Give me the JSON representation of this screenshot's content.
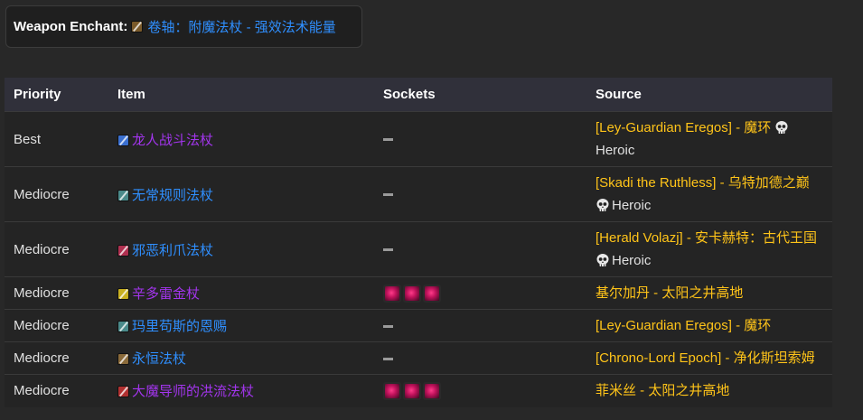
{
  "enchant": {
    "label": "Weapon Enchant:",
    "name": "卷轴：附魔法杖 - 强效法术能量",
    "icon": "scroll-icon",
    "color": "#2f8fff"
  },
  "table": {
    "headers": {
      "priority": "Priority",
      "item": "Item",
      "sockets": "Sockets",
      "source": "Source"
    },
    "rows": [
      {
        "priority": "Best",
        "item": "龙人战斗法杖",
        "item_quality": "epic",
        "item_icon": "staff-icon",
        "item_icon_color": "#3a6fd0",
        "sockets": "—",
        "sockets_count": 0,
        "source": "[Ley-Guardian Eregos] - 魔环",
        "heroic": "Heroic"
      },
      {
        "priority": "Mediocre",
        "item": "无常规则法杖",
        "item_quality": "rare",
        "item_icon": "staff-icon",
        "item_icon_color": "#4a8a8a",
        "sockets": "—",
        "sockets_count": 0,
        "source": "[Skadi the Ruthless] - 乌特加德之巅",
        "heroic": "Heroic"
      },
      {
        "priority": "Mediocre",
        "item": "邪恶利爪法杖",
        "item_quality": "rare",
        "item_icon": "staff-icon",
        "item_icon_color": "#b03050",
        "sockets": "—",
        "sockets_count": 0,
        "source": "[Herald Volazj] - 安卡赫特：古代王国",
        "heroic": "Heroic"
      },
      {
        "priority": "Mediocre",
        "item": "辛多雷金杖",
        "item_quality": "epic",
        "item_icon": "staff-icon",
        "item_icon_color": "#c8b020",
        "sockets": "",
        "sockets_count": 3,
        "source": "基尔加丹 - 太阳之井高地",
        "heroic": ""
      },
      {
        "priority": "Mediocre",
        "item": "玛里苟斯的恩赐",
        "item_quality": "rare",
        "item_icon": "staff-icon",
        "item_icon_color": "#4a8a8a",
        "sockets": "—",
        "sockets_count": 0,
        "source": "[Ley-Guardian Eregos] - 魔环",
        "heroic": ""
      },
      {
        "priority": "Mediocre",
        "item": "永恒法杖",
        "item_quality": "rare",
        "item_icon": "staff-icon",
        "item_icon_color": "#8a6a3a",
        "sockets": "—",
        "sockets_count": 0,
        "source": "[Chrono-Lord Epoch] - 净化斯坦索姆",
        "heroic": ""
      },
      {
        "priority": "Mediocre",
        "item": "大魔导师的洪流法杖",
        "item_quality": "epic",
        "item_icon": "staff-icon",
        "item_icon_color": "#b03030",
        "sockets": "",
        "sockets_count": 3,
        "source": "菲米丝 - 太阳之井高地",
        "heroic": ""
      }
    ]
  },
  "colors": {
    "epic": "#a335ee",
    "rare": "#2f8fff",
    "source": "#ffc419",
    "socket_gem": "#e0206e"
  }
}
